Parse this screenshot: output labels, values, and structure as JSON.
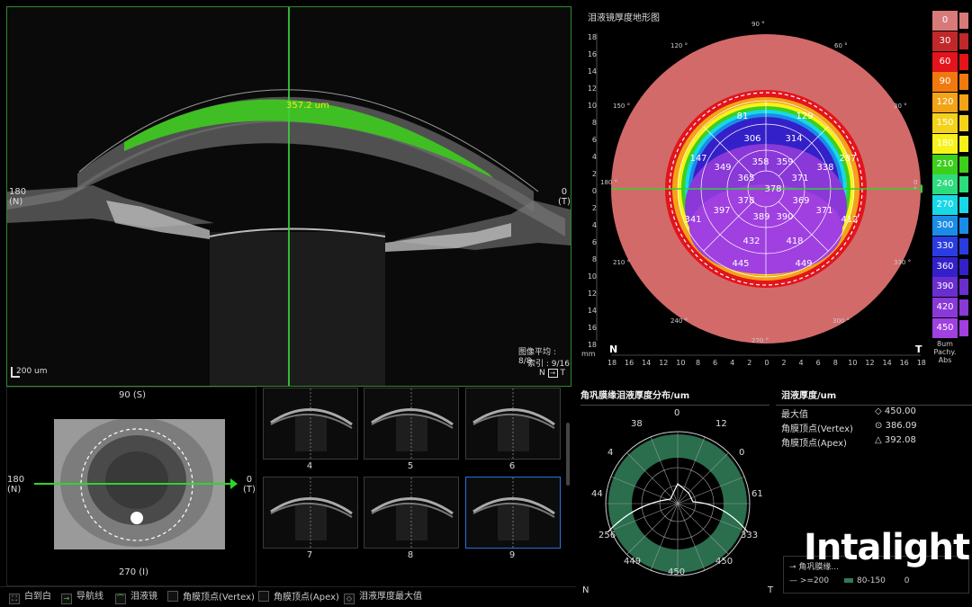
{
  "oct": {
    "measurement": "357.2 um",
    "left_label": [
      "180",
      "(N)"
    ],
    "right_label": [
      "0",
      "(T)"
    ],
    "scale_bar": "200 um",
    "avg_label": "图像平均 : 8/8",
    "index_label": "索引 : 9/16",
    "nt_label": "N",
    "nt_label2": "T"
  },
  "fundus": {
    "top_label": "90 (S)",
    "bottom_label": "270 (I)",
    "left_label": [
      "180",
      "(N)"
    ],
    "right_label": [
      "0",
      "(T)"
    ]
  },
  "thumbnails": [
    {
      "num": "4",
      "selected": false
    },
    {
      "num": "5",
      "selected": false
    },
    {
      "num": "6",
      "selected": false
    },
    {
      "num": "7",
      "selected": false
    },
    {
      "num": "8",
      "selected": false
    },
    {
      "num": "9",
      "selected": true
    }
  ],
  "topo": {
    "title": "泪液镜厚度地形图",
    "y_ticks": [
      "18",
      "16",
      "14",
      "12",
      "10",
      "8",
      "6",
      "4",
      "2",
      "0",
      "2",
      "4",
      "6",
      "8",
      "10",
      "12",
      "14",
      "16",
      "18"
    ],
    "x_ticks": [
      "18",
      "16",
      "14",
      "12",
      "10",
      "8",
      "6",
      "4",
      "2",
      "0",
      "2",
      "4",
      "6",
      "8",
      "10",
      "12",
      "14",
      "16",
      "18"
    ],
    "unit": "mm",
    "n_label": "N",
    "t_label": "T",
    "angle_labels": {
      "a90": "90 °",
      "a60": "60 °",
      "a120": "120 °",
      "a150": "150 °",
      "a180": "180 °",
      "a0": "0 °",
      "a210": "210 °",
      "a240": "240 °",
      "a270": "270 °",
      "a300": "300 °",
      "a330": "330 °",
      "a30": "30 °"
    },
    "values": {
      "v81": "81",
      "v129": "129",
      "v306": "306",
      "v314": "314",
      "v147": "147",
      "v287": "287",
      "v349": "349",
      "v358": "358",
      "v359": "359",
      "v338": "338",
      "v365": "365",
      "v371a": "371",
      "v378c": "378",
      "v378": "378",
      "v369": "369",
      "v397": "397",
      "v371b": "371",
      "v341": "341",
      "v412": "412",
      "v389": "389",
      "v390": "390",
      "v432": "432",
      "v418": "418",
      "v445": "445",
      "v449": "449"
    }
  },
  "scale": {
    "items": [
      {
        "label": "0",
        "color": "#d97a7a"
      },
      {
        "label": "30",
        "color": "#c0282a"
      },
      {
        "label": "60",
        "color": "#e3141c"
      },
      {
        "label": "90",
        "color": "#f07a10"
      },
      {
        "label": "120",
        "color": "#f3a318"
      },
      {
        "label": "150",
        "color": "#f5d21a"
      },
      {
        "label": "180",
        "color": "#f7f31a"
      },
      {
        "label": "210",
        "color": "#3ecf1c"
      },
      {
        "label": "240",
        "color": "#2ddc7c"
      },
      {
        "label": "270",
        "color": "#18d8e8"
      },
      {
        "label": "300",
        "color": "#1a8ce8"
      },
      {
        "label": "330",
        "color": "#2a3ce0"
      },
      {
        "label": "360",
        "color": "#3420c8"
      },
      {
        "label": "390",
        "color": "#6a2ed0"
      },
      {
        "label": "420",
        "color": "#8a38d8"
      },
      {
        "label": "450",
        "color": "#a040e0"
      }
    ],
    "footer": [
      "8um",
      "Pachy.",
      "Abs"
    ]
  },
  "ring": {
    "title": "角巩膜缘泪液厚度分布/um",
    "labels": {
      "top": "0",
      "t12": "12",
      "t0": "0",
      "r61": "61",
      "r333": "333",
      "b450r": "450",
      "b450": "450",
      "b449": "449",
      "l256": "256",
      "l44": "44",
      "l4": "4",
      "l38": "38"
    },
    "n_label": "N",
    "t_label": "T"
  },
  "stats": {
    "title": "泪液厚度/um",
    "rows": [
      {
        "label": "最大值",
        "symbol": "◇",
        "value": "450.00"
      },
      {
        "label": "角膜顶点(Vertex)",
        "symbol": "⊙",
        "value": "386.09"
      },
      {
        "label": "角膜顶点(Apex)",
        "symbol": "△",
        "value": "392.08"
      }
    ]
  },
  "logo": "Intalight",
  "legend": {
    "row1": "角巩膜缘...",
    "row2a": ">=200",
    "row2b": "80-150",
    "row2c": "0"
  },
  "toolbar": {
    "items": [
      {
        "label": "白到白"
      },
      {
        "label": "导航线"
      },
      {
        "label": "泪液镜"
      },
      {
        "label": "角膜顶点(Vertex)"
      },
      {
        "label": "角膜顶点(Apex)"
      },
      {
        "label": "泪液厚度最大值"
      }
    ]
  }
}
